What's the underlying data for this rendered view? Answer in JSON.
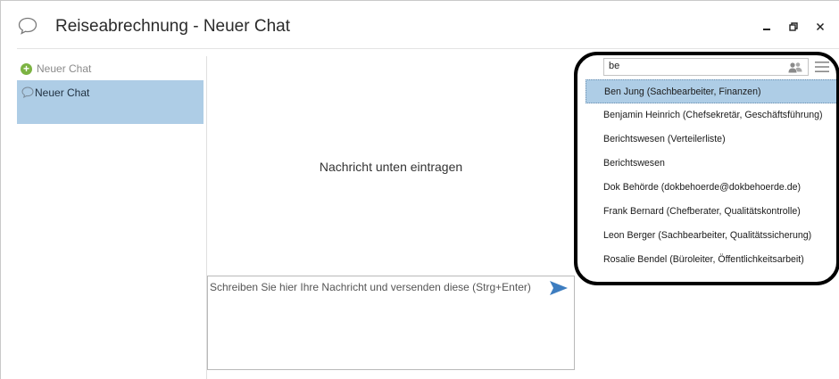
{
  "window": {
    "title": "Reiseabrechnung - Neuer Chat",
    "controls": {
      "minimize": "‒",
      "restore": "⧉",
      "close": "✕"
    }
  },
  "sidebar": {
    "new_chat_label": "Neuer Chat",
    "chats": [
      {
        "label": "Neuer Chat",
        "selected": true
      }
    ]
  },
  "main": {
    "empty_message": "Nachricht unten eintragen",
    "compose_placeholder": "Schreiben Sie hier Ihre Nachricht und versenden diese (Strg+Enter)"
  },
  "contact_search": {
    "query": "be",
    "results": [
      "Ben Jung (Sachbearbeiter, Finanzen)",
      "Benjamin Heinrich (Chefsekretär, Geschäftsführung)",
      "Berichtswesen (Verteilerliste)",
      "Berichtswesen",
      "Dok Behörde (dokbehoerde@dokbehoerde.de)",
      "Frank Bernard (Chefberater, Qualitätskontrolle)",
      "Leon Berger (Sachbearbeiter, Qualitätssicherung)",
      "Rosalie Bendel (Büroleiter, Öffentlichkeitsarbeit)"
    ],
    "selected_index": 0
  },
  "colors": {
    "selection": "#aecde6",
    "add_icon": "#7cb342",
    "send_icon": "#3d7dc0"
  },
  "icons": [
    "chat-bubble-icon",
    "plus-circle-icon",
    "send-arrow-icon",
    "people-icon",
    "hamburger-menu-icon",
    "minimize-icon",
    "restore-icon",
    "close-icon"
  ]
}
